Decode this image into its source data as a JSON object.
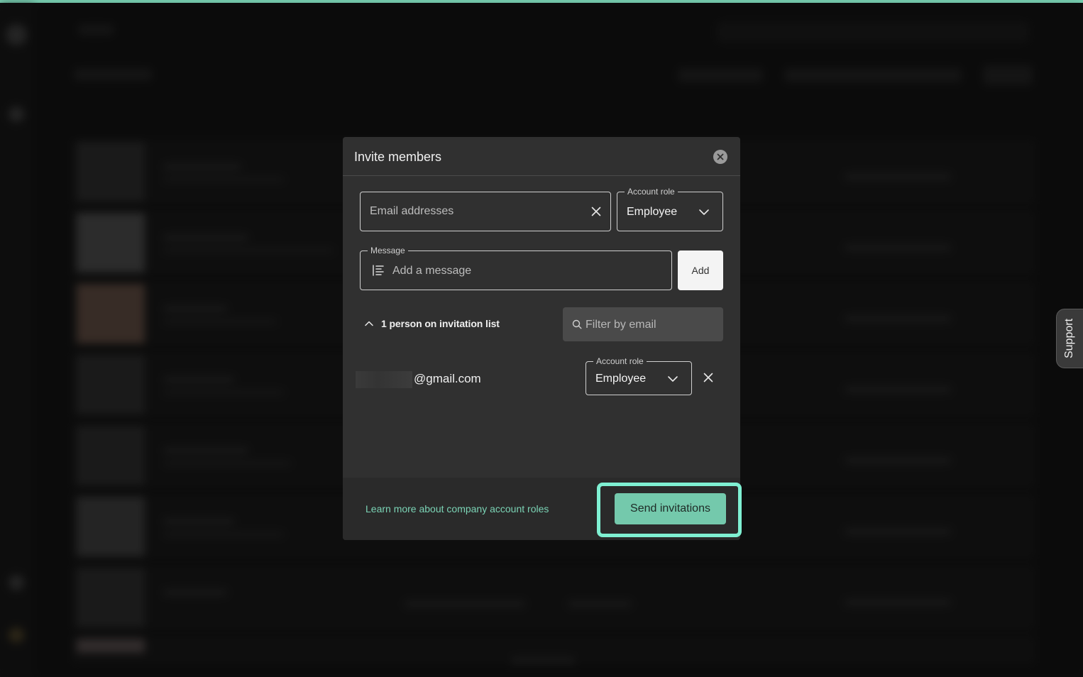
{
  "modal": {
    "title": "Invite members",
    "email_placeholder": "Email addresses",
    "account_role_label": "Account role",
    "account_role_value": "Employee",
    "message_label": "Message",
    "message_placeholder": "Add a message",
    "add_label": "Add",
    "invitation_list_label": "1 person on invitation list",
    "filter_placeholder": "Filter by email",
    "invitees": [
      {
        "email": "@gmail.com",
        "role_label": "Account role",
        "role": "Employee"
      }
    ],
    "learn_more_link": "Learn more about company account roles",
    "send_label": "Send invitations"
  },
  "support_tab": {
    "label": "Support"
  },
  "colors": {
    "accent": "#7bd3b5",
    "highlight": "#7ff0d2",
    "modal_bg": "#303030"
  }
}
